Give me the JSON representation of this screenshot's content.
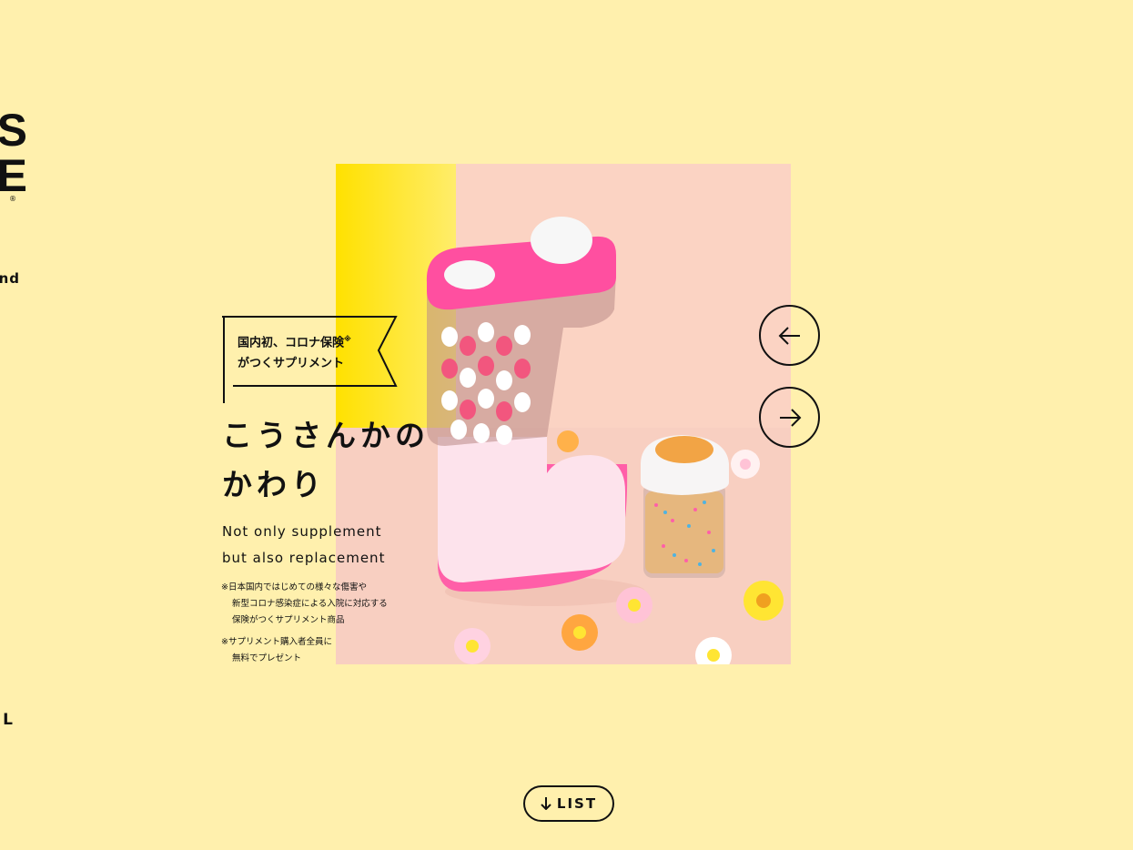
{
  "brand": {
    "logo_text": "S\nE",
    "registered_mark": "®",
    "side_label": "nd",
    "bottom_label": "L"
  },
  "hero": {
    "banner_line1": "国内初、コロナ保険",
    "banner_mark": "※",
    "banner_line2": "がつくサプリメント",
    "headline_line1": "こうさんかの",
    "headline_line2": "かわり",
    "sub_en_line1": "Not only supplement",
    "sub_en_line2": "but also replacement",
    "note1_line1": "※日本国内ではじめての様々な傷害や",
    "note1_line2": "新型コロナ感染症による入院に対応する",
    "note1_line3": "保険がつくサプリメント商品",
    "note2_line1": "※サプリメント購入者全員に",
    "note2_line2": "無料でプレゼント"
  },
  "controls": {
    "prev_icon": "arrow-left-icon",
    "next_icon": "arrow-right-icon",
    "list_icon": "arrow-down-icon",
    "list_label": "LIST"
  },
  "colors": {
    "background": "#fff0ad",
    "accent_pink": "#ff5fa8",
    "accent_yellow": "#ffe100"
  }
}
